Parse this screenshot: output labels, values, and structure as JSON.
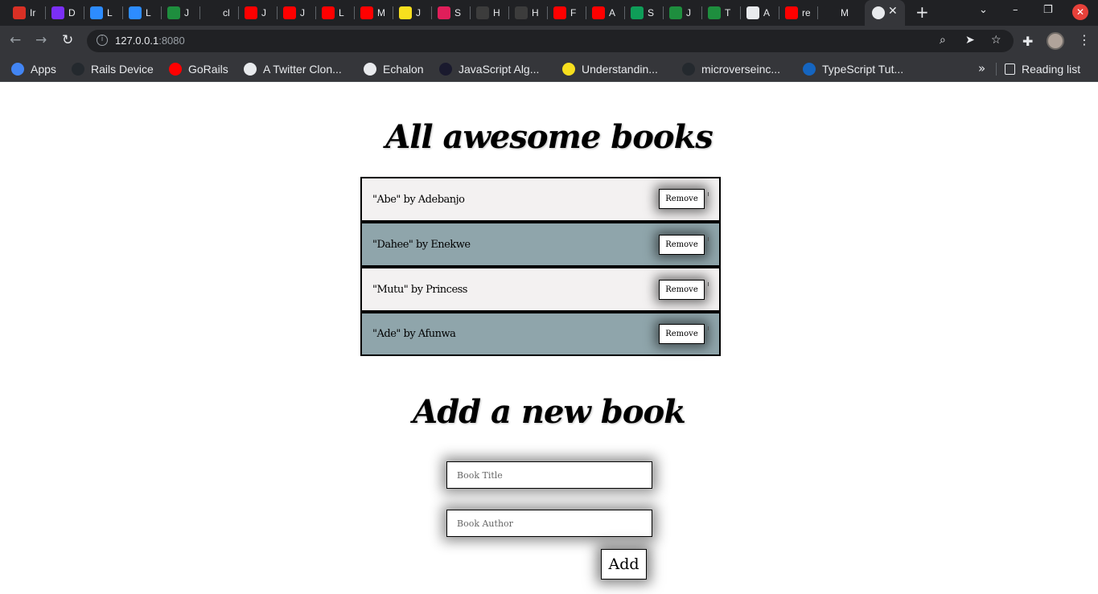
{
  "browser": {
    "tabs": [
      {
        "icon": "gmail-icon",
        "initial": "Ir",
        "color": "#d93025"
      },
      {
        "icon": "microverse-icon",
        "initial": "D",
        "color": "#7b2ff7"
      },
      {
        "icon": "zoom-icon",
        "initial": "L",
        "color": "#2d8cff"
      },
      {
        "icon": "zoom-icon",
        "initial": "L",
        "color": "#2d8cff"
      },
      {
        "icon": "w-icon",
        "initial": "J",
        "color": "#1e8e3e"
      },
      {
        "icon": "github-icon",
        "initial": "cl",
        "color": "#202124"
      },
      {
        "icon": "youtube-icon",
        "initial": "J",
        "color": "#ff0000"
      },
      {
        "icon": "youtube-icon",
        "initial": "J",
        "color": "#ff0000"
      },
      {
        "icon": "youtube-icon",
        "initial": "L",
        "color": "#ff0000"
      },
      {
        "icon": "youtube-icon",
        "initial": "M",
        "color": "#ff0000"
      },
      {
        "icon": "js-icon",
        "initial": "J",
        "color": "#f7df1e"
      },
      {
        "icon": "slack-icon",
        "initial": "S",
        "color": "#e01e5a"
      },
      {
        "icon": "f-icon",
        "initial": "H",
        "color": "#3c3c3c"
      },
      {
        "icon": "f-icon",
        "initial": "H",
        "color": "#3c3c3c"
      },
      {
        "icon": "youtube-icon",
        "initial": "F",
        "color": "#ff0000"
      },
      {
        "icon": "youtube-icon",
        "initial": "A",
        "color": "#ff0000"
      },
      {
        "icon": "n-icon",
        "initial": "S",
        "color": "#0f9d58"
      },
      {
        "icon": "w-icon",
        "initial": "J",
        "color": "#1e8e3e"
      },
      {
        "icon": "w-icon",
        "initial": "T",
        "color": "#1e8e3e"
      },
      {
        "icon": "globe-icon",
        "initial": "A",
        "color": "#e8eaed"
      },
      {
        "icon": "youtube-icon",
        "initial": "re",
        "color": "#ff0000"
      },
      {
        "icon": "github-icon",
        "initial": "M",
        "color": "#202124"
      }
    ],
    "active_tab_close": "✕",
    "new_tab": "+",
    "url_host": "127.0.0.1",
    "url_port": ":8080",
    "bookmarks": [
      {
        "label": "Apps",
        "icon": "apps-grid-icon",
        "color": "#4285f4"
      },
      {
        "label": "Rails Device",
        "icon": "github-icon",
        "color": "#24292e"
      },
      {
        "label": "GoRails",
        "icon": "youtube-icon",
        "color": "#ff0000"
      },
      {
        "label": "A Twitter Clon...",
        "icon": "bookmark-page-icon",
        "color": "#e8eaed"
      },
      {
        "label": "Echalon",
        "icon": "globe-icon",
        "color": "#e8eaed"
      },
      {
        "label": "JavaScript Alg...",
        "icon": "algorithms-icon",
        "color": "#1a1a2e"
      },
      {
        "label": "Understandin...",
        "icon": "js-icon",
        "color": "#f7df1e"
      },
      {
        "label": "microverseinc...",
        "icon": "github-icon",
        "color": "#24292e"
      },
      {
        "label": "TypeScript Tut...",
        "icon": "ts-icon",
        "color": "#1565c0"
      }
    ],
    "bookmarks_more": "»",
    "reading_list": "Reading list"
  },
  "page": {
    "books_heading": "All awesome books",
    "books": [
      {
        "text": "\"Abe\" by Adebanjo",
        "remove_label": "Remove"
      },
      {
        "text": "\"Dahee\" by Enekwe",
        "remove_label": "Remove"
      },
      {
        "text": "\"Mutu\" by Princess",
        "remove_label": "Remove"
      },
      {
        "text": "\"Ade\" by Afunwa",
        "remove_label": "Remove"
      }
    ],
    "add_heading": "Add a new book",
    "title_placeholder": "Book Title",
    "author_placeholder": "Book Author",
    "add_label": "Add"
  },
  "colors": {
    "row_light": "#f3f1f1",
    "row_dark": "#8fa5ab"
  }
}
